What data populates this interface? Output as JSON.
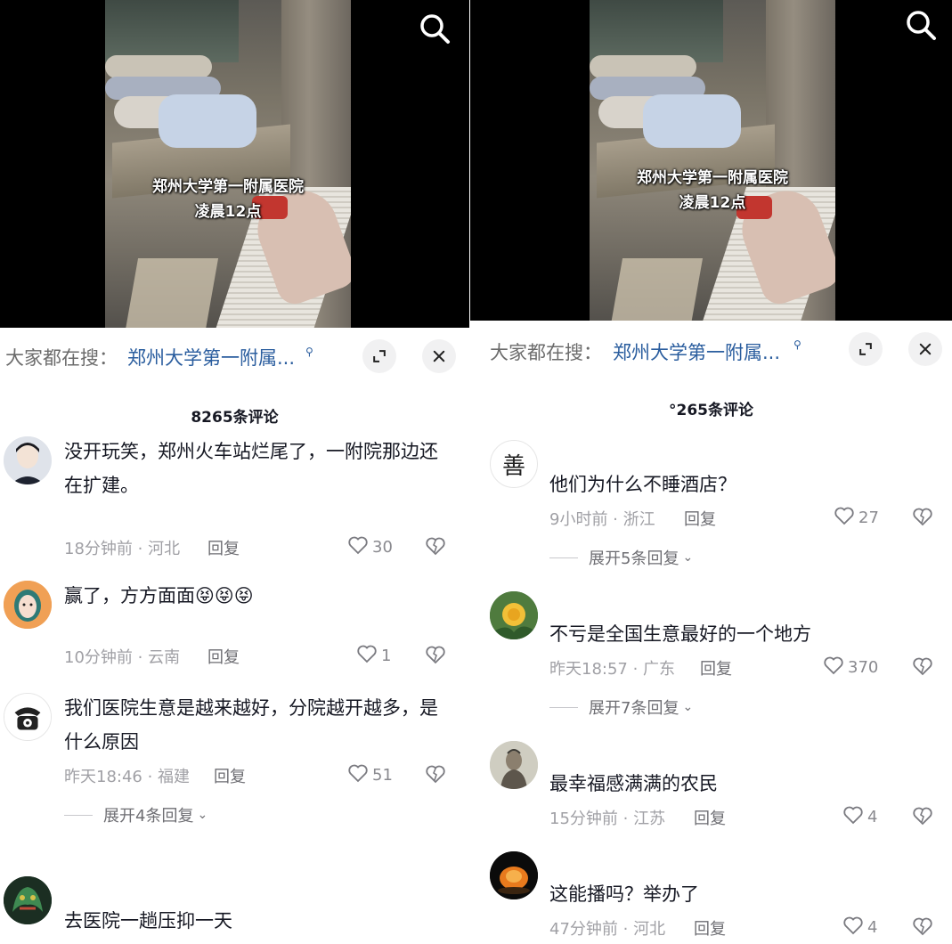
{
  "video": {
    "caption_line1": "郑州大学第一附属医院",
    "caption_line2": "凌晨12点",
    "search_icon": "search-icon"
  },
  "suggest": {
    "prefix": "大家都在搜：",
    "query": "郑州大学第一附属...",
    "icon": "search-icon"
  },
  "left": {
    "comment_count": "8265条评论",
    "comments": [
      {
        "text": "没开玩笑，郑州火车站烂尾了，一附院那边还在扩建。",
        "time": "18分钟前 · 河北",
        "reply": "回复",
        "likes": "30"
      },
      {
        "text": "赢了，方方面面😝😝😝",
        "time": "10分钟前 · 云南",
        "reply": "回复",
        "likes": "1"
      },
      {
        "text": "我们医院生意是越来越好，分院越开越多，是什么原因",
        "time": "昨天18:46 · 福建",
        "reply": "回复",
        "likes": "51",
        "expand": "展开4条回复"
      },
      {
        "text": "去医院一趟压抑一天"
      }
    ]
  },
  "right": {
    "comment_count": "°265条评论",
    "comments": [
      {
        "text": "他们为什么不睡酒店？",
        "time": "9小时前 · 浙江",
        "reply": "回复",
        "likes": "27",
        "expand": "展开5条回复",
        "avatar_char": "善"
      },
      {
        "text": "不亏是全国生意最好的一个地方",
        "time": "昨天18:57 · 广东",
        "reply": "回复",
        "likes": "370",
        "expand": "展开7条回复"
      },
      {
        "text": "最幸福感满满的农民",
        "time": "15分钟前 · 江苏",
        "reply": "回复",
        "likes": "4"
      },
      {
        "text": "这能播吗？举办了",
        "time": "47分钟前 · 河北",
        "reply": "回复",
        "likes": "4"
      }
    ]
  },
  "icons": {
    "expand": "expand-icon",
    "close": "close-icon",
    "like": "heart-icon",
    "dislike": "broken-heart-icon",
    "chevron": "chevron-down-icon"
  },
  "colors": {
    "link": "#2a5d9e",
    "meta": "#a0a0a5",
    "text": "#161823"
  }
}
